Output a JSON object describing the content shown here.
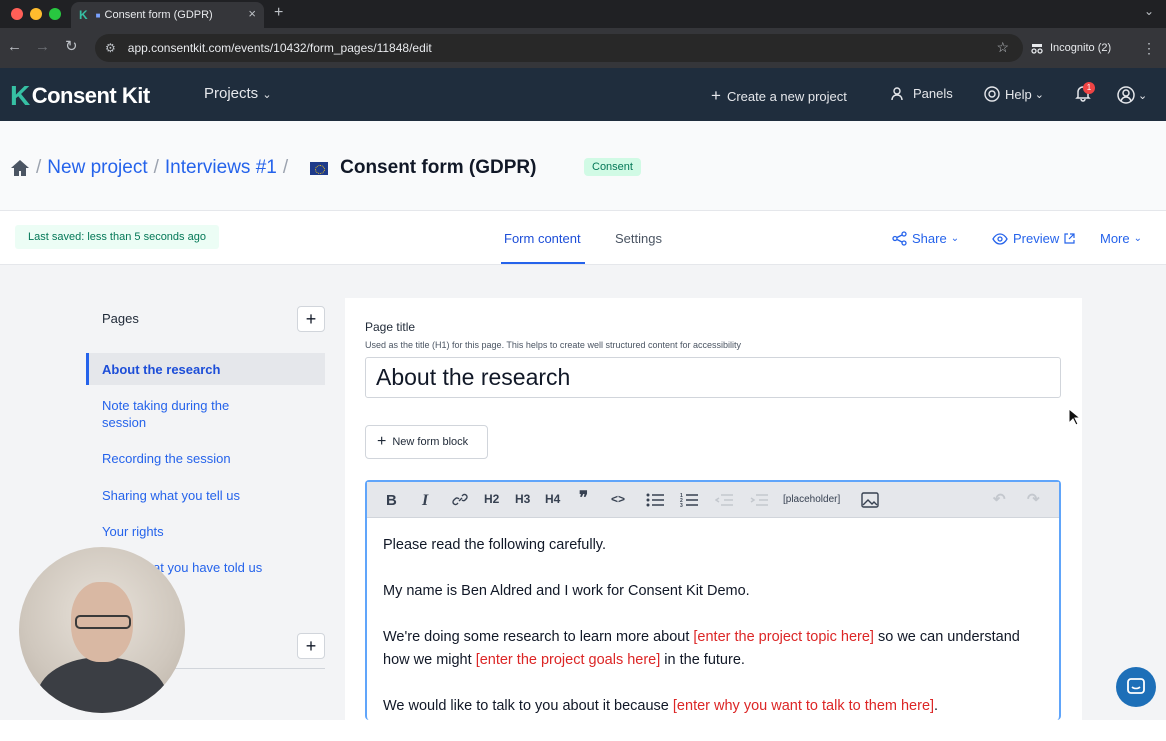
{
  "browser": {
    "tab_title": "Consent form (GDPR)",
    "url": "app.consentkit.com/events/10432/form_pages/11848/edit",
    "incognito_label": "Incognito (2)"
  },
  "appnav": {
    "logo_text": "Consent Kit",
    "projects_label": "Projects",
    "create_label": "Create a new project",
    "panels_label": "Panels",
    "help_label": "Help",
    "notifications_count": "1"
  },
  "breadcrumb": {
    "items": [
      "New project",
      "Interviews #1"
    ],
    "current": "Consent form (GDPR)",
    "badge": "Consent"
  },
  "tabsbar": {
    "saved": "Last saved: less than 5 seconds ago",
    "tabs": [
      "Form content",
      "Settings"
    ],
    "share": "Share",
    "preview": "Preview",
    "more": "More"
  },
  "sidebar": {
    "title": "Pages",
    "items": [
      "About the research",
      "Note taking during the session",
      "Recording the session",
      "Sharing what you tell us",
      "Your rights",
      "...hat you have told us"
    ]
  },
  "form": {
    "page_title_label": "Page title",
    "page_title_help": "Used as the title (H1) for this page. This helps to create well structured content for accessibility",
    "page_title_value": "About the research",
    "new_block": "New form block",
    "toolbar": [
      "B",
      "I",
      "link",
      "H2",
      "H3",
      "H4",
      "quote",
      "code",
      "bullet-list",
      "numbered-list",
      "outdent",
      "indent",
      "[placeholder]",
      "image",
      "undo",
      "redo"
    ],
    "placeholder_label": "[placeholder]"
  },
  "editor": {
    "p1": "Please read the following carefully.",
    "p2": "My name is Ben Aldred and I work for Consent Kit Demo.",
    "p3a": "We're doing some research to learn more about ",
    "p3b": "[enter the project topic here]",
    "p3c": " so we can understand how we might ",
    "p3d": "[enter the project goals here]",
    "p3e": " in the future.",
    "p4a": "We would like to talk to you about it because ",
    "p4b": "[enter why you want to talk to them here]",
    "p4c": "."
  },
  "colors": {
    "accent": "#2563eb",
    "nav_bg": "#1f2d3d",
    "brand": "#36c0a4",
    "placeholder_red": "#dc2626"
  }
}
